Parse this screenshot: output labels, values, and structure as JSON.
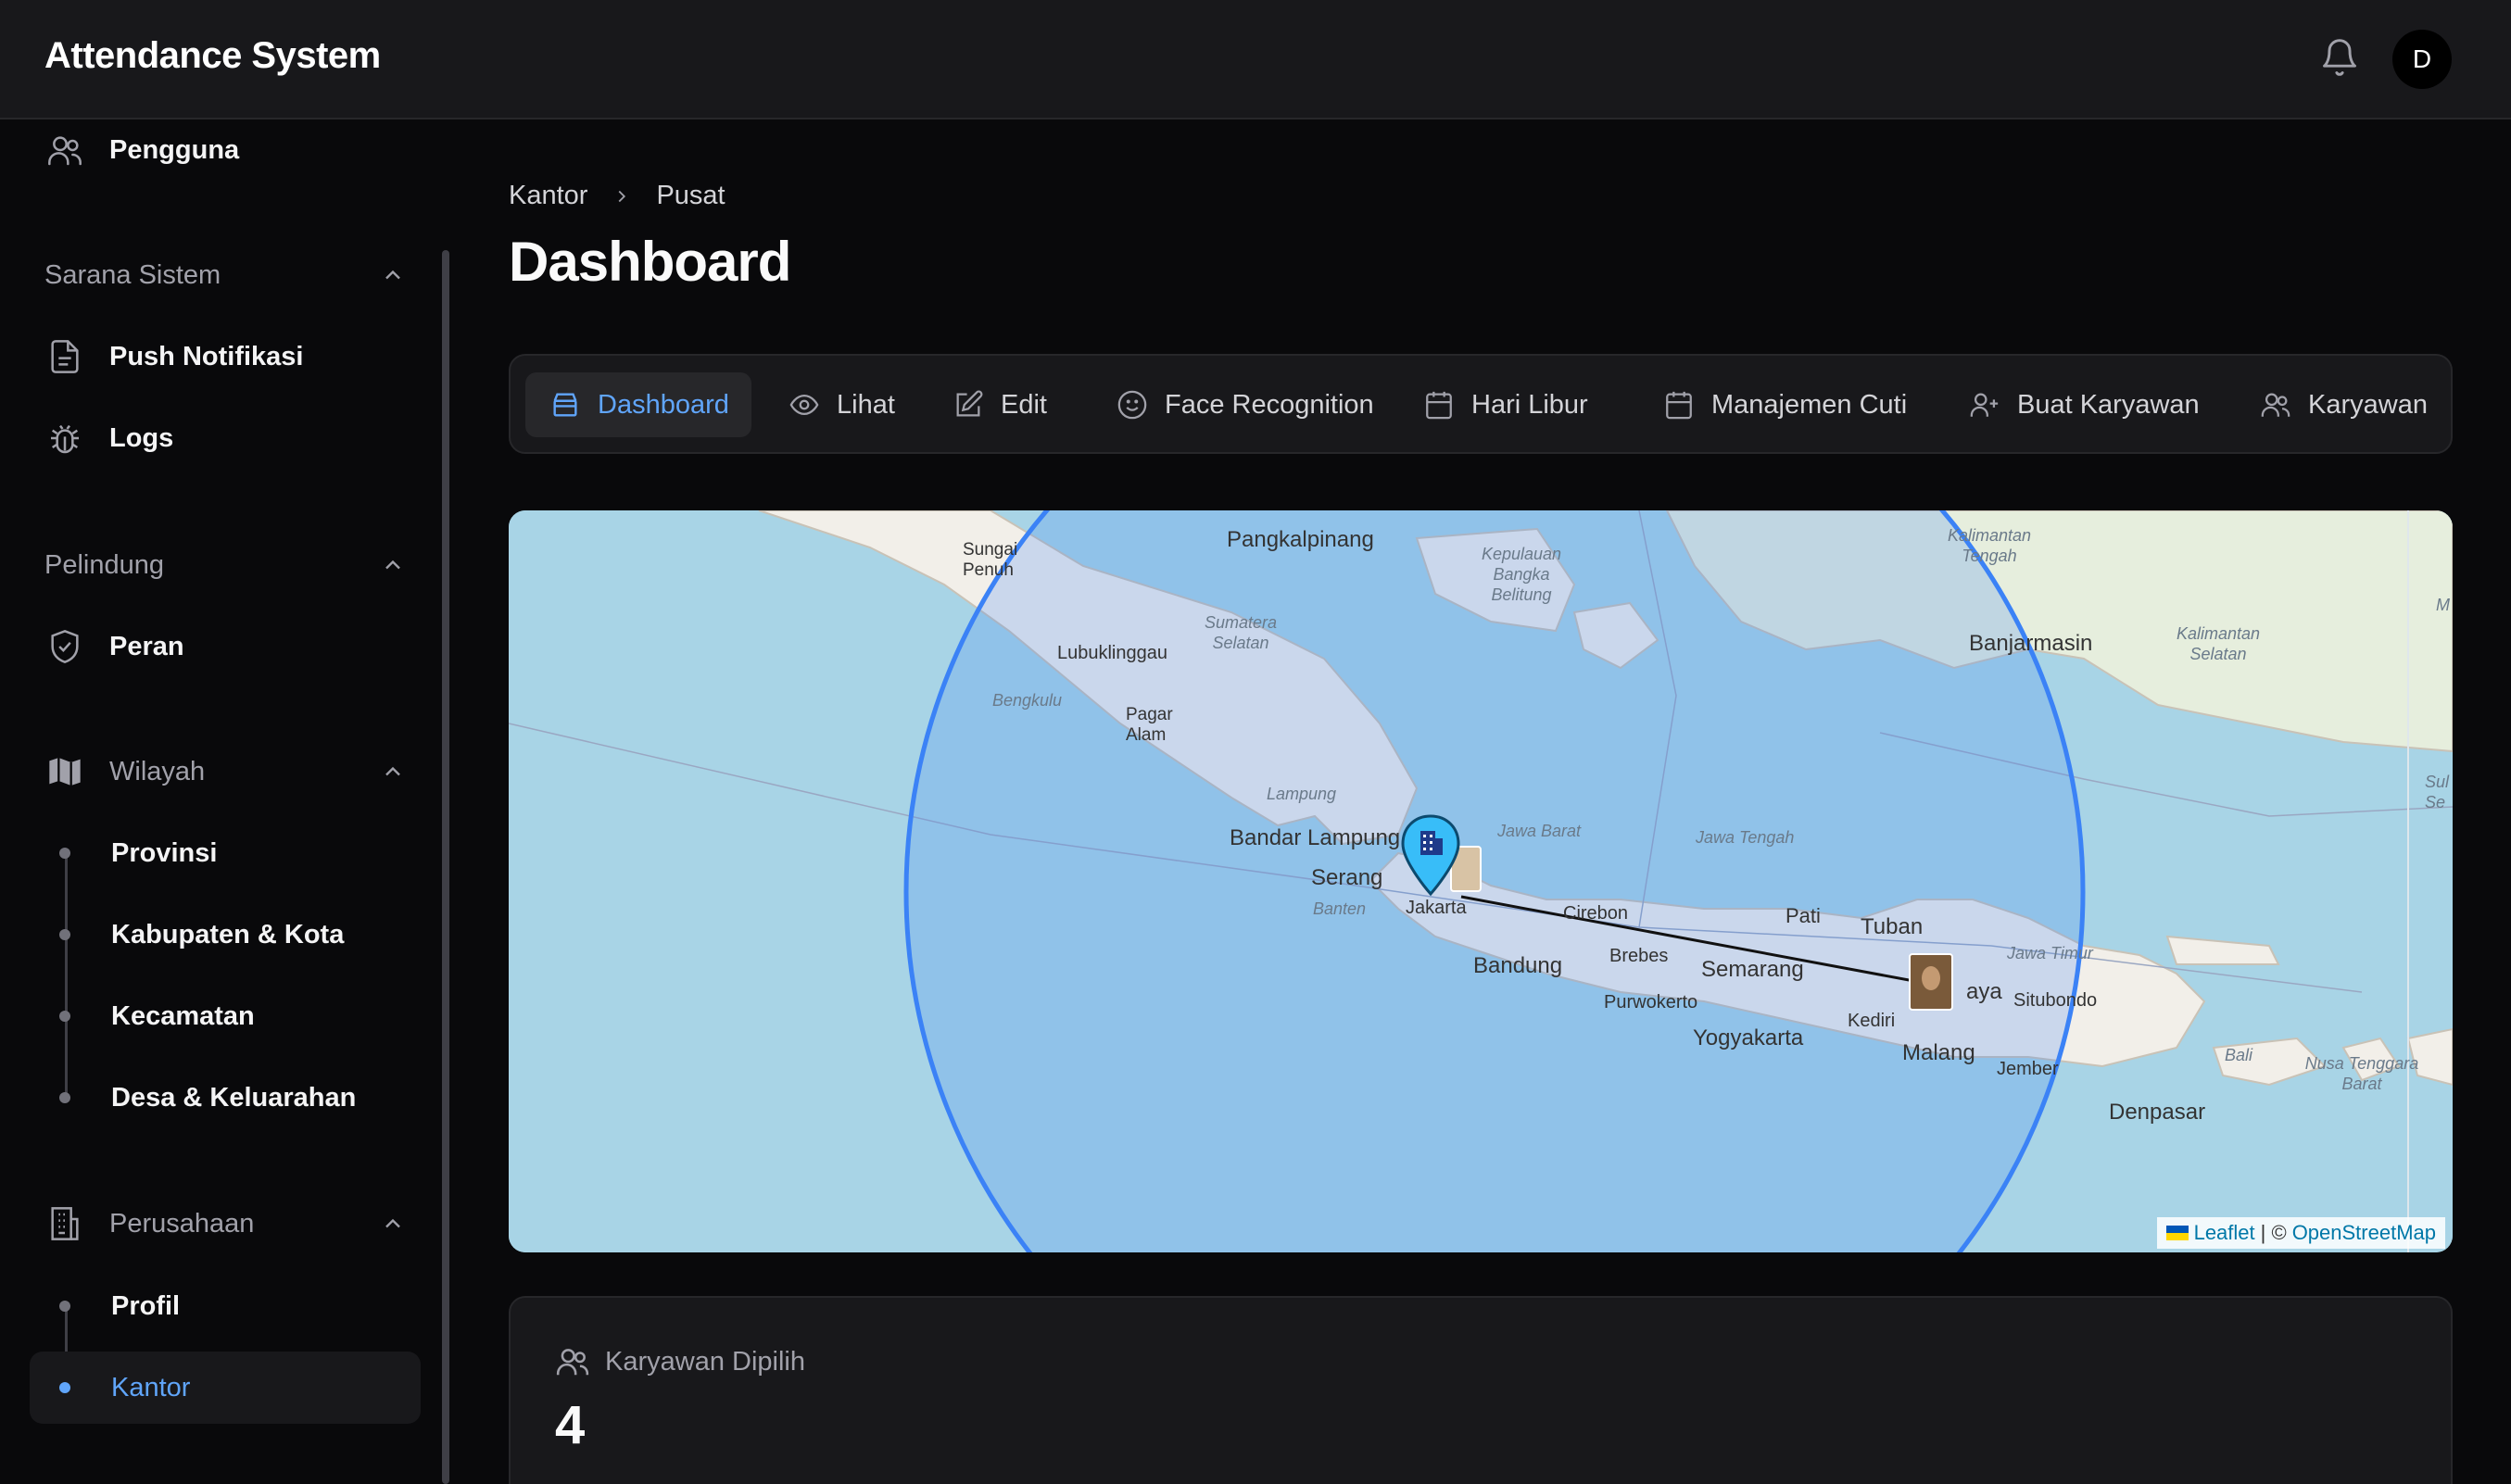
{
  "app": {
    "title": "Attendance System",
    "avatar_initial": "D"
  },
  "sidebar": {
    "top_item": {
      "label": "Pengguna",
      "icon": "users-icon"
    },
    "groups": [
      {
        "label": "Sarana Sistem",
        "items": [
          {
            "label": "Push Notifikasi",
            "icon": "file-icon"
          },
          {
            "label": "Logs",
            "icon": "bug-icon"
          }
        ]
      },
      {
        "label": "Pelindung",
        "items": [
          {
            "label": "Peran",
            "icon": "shield-icon"
          }
        ]
      },
      {
        "label": "Wilayah",
        "icon": "map-icon",
        "items": [
          {
            "label": "Provinsi"
          },
          {
            "label": "Kabupaten & Kota"
          },
          {
            "label": "Kecamatan"
          },
          {
            "label": "Desa & Keluarahan"
          }
        ]
      },
      {
        "label": "Perusahaan",
        "icon": "building-icon",
        "items": [
          {
            "label": "Profil"
          },
          {
            "label": "Kantor",
            "active": true
          }
        ]
      }
    ]
  },
  "breadcrumb": [
    "Kantor",
    "Pusat"
  ],
  "page_title": "Dashboard",
  "tabs": [
    {
      "label": "Dashboard",
      "icon": "box-icon",
      "active": true
    },
    {
      "label": "Lihat",
      "icon": "eye-icon"
    },
    {
      "label": "Edit",
      "icon": "edit-icon"
    },
    {
      "label": "Face Recognition",
      "icon": "smile-icon"
    },
    {
      "label": "Hari Libur",
      "icon": "calendar-days-icon"
    },
    {
      "label": "Manajemen Cuti",
      "icon": "calendar-icon"
    },
    {
      "label": "Buat Karyawan",
      "icon": "user-plus-icon"
    },
    {
      "label": "Karyawan",
      "icon": "users-icon"
    }
  ],
  "map": {
    "cities": [
      "Pangkalpinang",
      "Banjarmasin",
      "Lubuklinggau",
      "Pagar Alam",
      "Bandar Lampung",
      "Serang",
      "Jakarta",
      "Cirebon",
      "Brebes",
      "Bandung",
      "Purwokerto",
      "Semarang",
      "Pati",
      "Tuban",
      "Kediri",
      "Yogyakarta",
      "Malang",
      "Situbondo",
      "Jember",
      "Denpasar",
      "Sungai Penuh",
      "aya"
    ],
    "regions": [
      "Kepulauan Bangka Belitung",
      "Sumatera Selatan",
      "Bengkulu",
      "Lampung",
      "Banten",
      "Jawa Barat",
      "Jawa Tengah",
      "Jawa Timur",
      "Kalimantan Tengah",
      "Kalimantan Selatan",
      "Bali",
      "Nusa Tenggara Barat",
      "Sul Se",
      "M"
    ],
    "attribution": {
      "leaflet": "Leaflet",
      "sep": "| ©",
      "osm": "OpenStreetMap"
    },
    "colors": {
      "sea": "#a8d4e6",
      "land": "#f2efe9",
      "radius": "#3b82f6"
    }
  },
  "stat_card": {
    "label": "Karyawan Dipilih",
    "value": "4"
  }
}
